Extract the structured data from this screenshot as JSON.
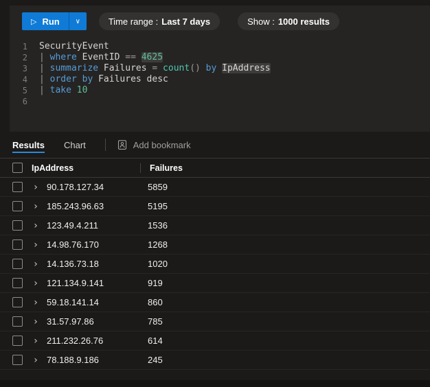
{
  "toolbar": {
    "run_label": "Run",
    "time_range_label": "Time range :",
    "time_range_value": "Last 7 days",
    "show_label": "Show :",
    "show_value": "1000 results"
  },
  "icons": {
    "play": "▷",
    "chevron_down": "∨",
    "expand": "›"
  },
  "editor": {
    "token_colors": {
      "plain": "#d7d5d2",
      "keyword": "#569cd6",
      "operator": "#9b9a98",
      "number": "#5fbf9c",
      "function": "#4ec9b0",
      "highlight_bg": "#3d3c3a"
    },
    "lines": [
      {
        "num": "1",
        "tokens": [
          [
            "plain",
            "SecurityEvent"
          ]
        ]
      },
      {
        "num": "2",
        "tokens": [
          [
            "op",
            "| "
          ],
          [
            "kw",
            "where"
          ],
          [
            "plain",
            " EventID "
          ],
          [
            "op",
            "== "
          ],
          [
            "hlnum",
            "4625"
          ]
        ]
      },
      {
        "num": "3",
        "tokens": [
          [
            "op",
            "| "
          ],
          [
            "kw",
            "summarize"
          ],
          [
            "plain",
            " Failures "
          ],
          [
            "op",
            "= "
          ],
          [
            "fn",
            "count"
          ],
          [
            "op",
            "()"
          ],
          [
            "kw",
            " by"
          ],
          [
            "plain",
            " "
          ],
          [
            "hlid",
            "IpAddress"
          ]
        ]
      },
      {
        "num": "4",
        "tokens": [
          [
            "op",
            "| "
          ],
          [
            "kw",
            "order by"
          ],
          [
            "plain",
            " Failures desc"
          ]
        ]
      },
      {
        "num": "5",
        "tokens": [
          [
            "op",
            "| "
          ],
          [
            "kw",
            "take "
          ],
          [
            "num",
            "10"
          ]
        ]
      },
      {
        "num": "6",
        "tokens": []
      }
    ]
  },
  "tabs": {
    "results": "Results",
    "chart": "Chart",
    "add_bookmark": "Add bookmark"
  },
  "table": {
    "columns": [
      "IpAddress",
      "Failures"
    ],
    "rows": [
      {
        "ip": "90.178.127.34",
        "failures": "5859"
      },
      {
        "ip": "185.243.96.63",
        "failures": "5195"
      },
      {
        "ip": "123.49.4.211",
        "failures": "1536"
      },
      {
        "ip": "14.98.76.170",
        "failures": "1268"
      },
      {
        "ip": "14.136.73.18",
        "failures": "1020"
      },
      {
        "ip": "121.134.9.141",
        "failures": "919"
      },
      {
        "ip": "59.18.141.14",
        "failures": "860"
      },
      {
        "ip": "31.57.97.86",
        "failures": "785"
      },
      {
        "ip": "211.232.26.76",
        "failures": "614"
      },
      {
        "ip": "78.188.9.186",
        "failures": "245"
      }
    ]
  },
  "colors": {
    "background": "#1b1a19",
    "panel": "#252423",
    "run_button": "#0f7bd7",
    "pill": "#333231",
    "tab_underline": "#2b88d8",
    "header_text": "#ffffff",
    "muted_text": "#a19f9d"
  }
}
